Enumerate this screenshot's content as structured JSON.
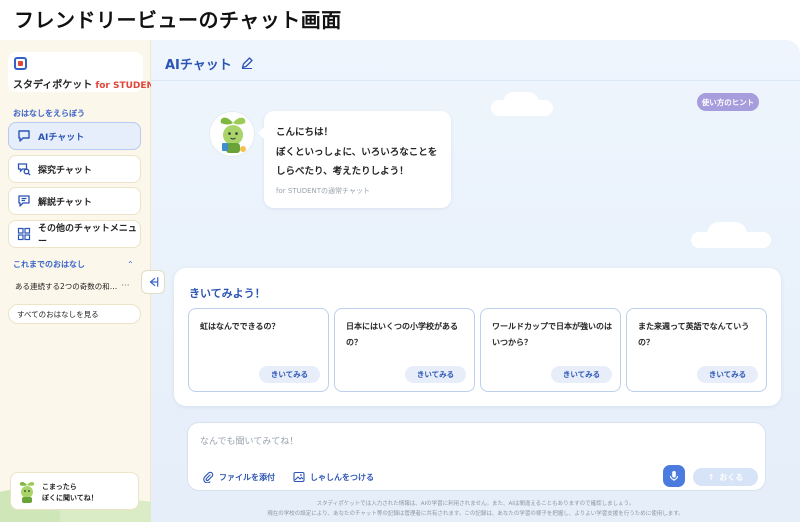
{
  "page": {
    "heading": "フレンドリービューのチャット画面"
  },
  "sidebar": {
    "logo": {
      "main": "スタディポケット",
      "sub": "for STUDENT"
    },
    "section_label": "おはなしをえらぼう",
    "menu": [
      {
        "label": "AIチャット",
        "icon": "chat-bubble-icon"
      },
      {
        "label": "探究チャット",
        "icon": "search-chat-icon"
      },
      {
        "label": "解説チャット",
        "icon": "explanation-chat-icon"
      },
      {
        "label": "その他のチャットメニュー",
        "icon": "grid-icon"
      }
    ],
    "history_label": "これまでのおはなし",
    "history_items": [
      "ある連続する2つの奇数の和…"
    ],
    "all_history_label": "すべてのおはなしを見る",
    "help": {
      "line1": "こまったら",
      "line2": "ぼくに聞いてね！"
    }
  },
  "main": {
    "title": "AIチャット",
    "hint_button": "使い方のヒント",
    "greeting": {
      "lines": [
        "こんにちは！",
        "ぼくといっしょに、いろいろなことを",
        "しらべたり、考えたりしよう！"
      ],
      "subtitle": "for STUDENTの通常チャット"
    },
    "suggestions": {
      "title": "きいてみよう！",
      "button_label": "きいてみる",
      "cards": [
        {
          "question": "虹はなんでできるの？"
        },
        {
          "question": "日本にはいくつの小学校があるの？"
        },
        {
          "question": "ワールドカップで日本が強いのはいつから？"
        },
        {
          "question": "また来週って英語でなんていうの？"
        }
      ]
    },
    "input": {
      "placeholder": "なんでも聞いてみてね！",
      "attach_label": "ファイルを添付",
      "photo_label": "しゃしんをつける",
      "send_label": "おくる"
    },
    "disclaimer": [
      "スタディポケットでは入力された情報は、AIの学習に利用されません。また、AIは間違えることもありますので確認しましょう。",
      "現在の学校の設定により、あなたのチャット等の記録は管理者に共有されます。この記録は、あなたの学習の様子を把握し、よりよい学習支援を行うために使用します。"
    ]
  },
  "colors": {
    "accent": "#2c54b4",
    "sidebar_bg": "#fbf7ea",
    "main_bg": "#eef5fd",
    "hint": "#a79ddc"
  }
}
